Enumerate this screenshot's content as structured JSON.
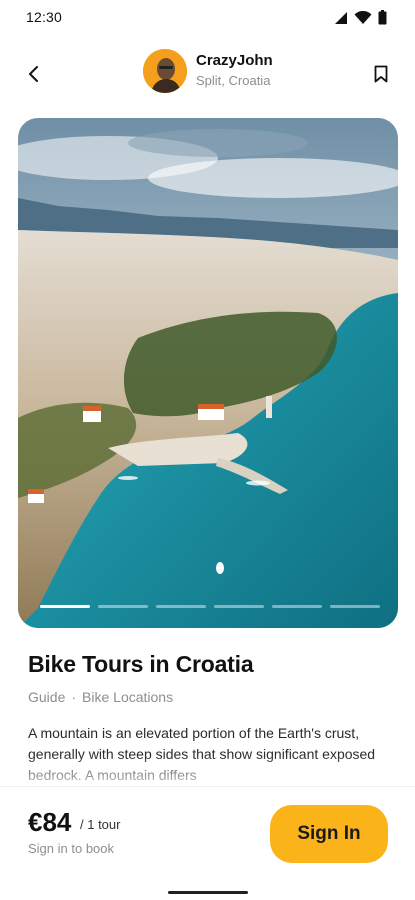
{
  "status_bar": {
    "time": "12:30",
    "icons": [
      "signal-icon",
      "wifi-icon",
      "battery-icon"
    ]
  },
  "header": {
    "author_name": "CrazyJohn",
    "author_location": "Split, Croatia",
    "back_icon": "chevron-left-icon",
    "bookmark_icon": "bookmark-icon"
  },
  "hero": {
    "page_count": 6,
    "active_page": 1
  },
  "tour": {
    "title": "Bike Tours in Croatia",
    "category": "Guide",
    "separator": "·",
    "subcategory": "Bike Locations",
    "description": "A mountain is an elevated portion of the Earth's crust, generally with steep sides that show significant exposed bedrock. A mountain differs"
  },
  "booking": {
    "price": "€84",
    "price_unit": "/ 1 tour",
    "note": "Sign in to book",
    "cta_label": "Sign In"
  },
  "colors": {
    "accent": "#fbb31a",
    "muted_text": "#8e8e8e",
    "sea": "#1b8fa0"
  }
}
